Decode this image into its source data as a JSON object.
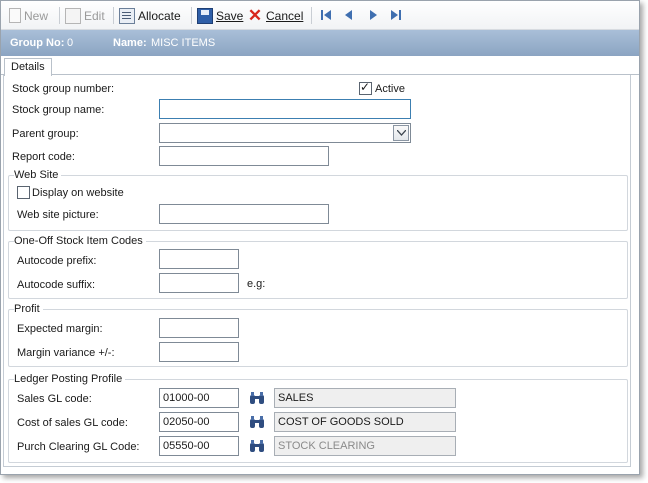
{
  "toolbar": {
    "new_label": "New",
    "edit_label": "Edit",
    "allocate_label": "Allocate",
    "save_label": "Save",
    "cancel_label": "Cancel"
  },
  "header": {
    "group_no_caption": "Group No:",
    "group_no_value": "0",
    "name_caption": "Name:",
    "name_value": "MISC ITEMS"
  },
  "tabs": [
    "Details"
  ],
  "form": {
    "stock_group_number_label": "Stock group number:",
    "active_label": "Active",
    "active_checked": true,
    "stock_group_name_label": "Stock group name:",
    "stock_group_name_value": "",
    "parent_group_label": "Parent group:",
    "parent_group_value": "",
    "report_code_label": "Report code:",
    "report_code_value": ""
  },
  "web_site": {
    "title": "Web Site",
    "display_label": "Display on website",
    "display_checked": false,
    "picture_label": "Web site picture:",
    "picture_value": ""
  },
  "one_off": {
    "title": "One-Off Stock Item Codes",
    "prefix_label": "Autocode prefix:",
    "prefix_value": "",
    "suffix_label": "Autocode suffix:",
    "suffix_value": "",
    "example_label": "e.g:"
  },
  "profit": {
    "title": "Profit",
    "margin_label": "Expected margin:",
    "margin_value": "",
    "variance_label": "Margin variance +/-:",
    "variance_value": ""
  },
  "ledger": {
    "title": "Ledger Posting Profile",
    "sales_label": "Sales GL code:",
    "sales_code": "01000-00",
    "sales_desc": "SALES",
    "cos_label": "Cost of sales GL code:",
    "cos_code": "02050-00",
    "cos_desc": "COST OF GOODS SOLD",
    "purch_label": "Purch Clearing GL Code:",
    "purch_code": "05550-00",
    "purch_desc": "STOCK CLEARING"
  },
  "colors": {
    "header_bar": "#9bb2ce",
    "focus_border": "#3c7fb1",
    "cancel_icon": "#d8261c"
  }
}
